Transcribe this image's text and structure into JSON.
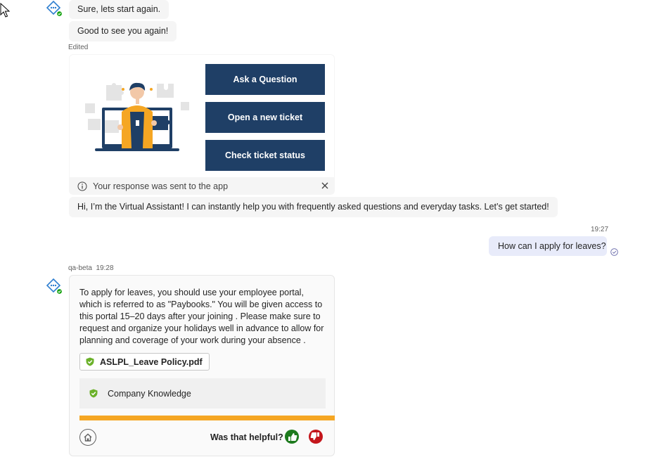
{
  "messages": {
    "msg1": "Sure, lets start again.",
    "msg2": "Good to see you again!",
    "edited": "Edited",
    "card": {
      "buttons": [
        "Ask a Question",
        "Open a new ticket",
        "Check ticket status"
      ],
      "notice": "Your response was sent to the app"
    },
    "intro": "Hi, I’m the Virtual Assistant! I can instantly help you with frequently asked questions and everyday tasks. Let’s get started!",
    "user": {
      "time": "19:27",
      "text": "How can I apply for leaves?"
    },
    "reply": {
      "sender": "qa-beta",
      "time": "19:28",
      "text": "To apply for leaves, you should use your employee portal, which is referred to as \"Paybooks.\" You will be given access to this portal 15–20 days after your joining . Please make sure to request and organize your holidays well in advance to allow for planning and coverage of your work during your absence .",
      "file": "ASLPL_Leave Policy.pdf",
      "knowledge": "Company Knowledge",
      "helpful": "Was that helpful?"
    }
  },
  "colors": {
    "button_bg": "#1f3f66",
    "accent_orange": "#f5a623",
    "user_bubble": "#e8ebfa",
    "presence_green": "#13a10e",
    "thumb_up": "#1e7b1e",
    "thumb_down": "#c4161c"
  },
  "icons": [
    "cursor-icon",
    "bot-avatar-icon",
    "info-icon",
    "close-icon",
    "read-receipt-icon",
    "shield-check-icon",
    "home-icon",
    "thumbs-up-icon",
    "thumbs-down-icon"
  ]
}
